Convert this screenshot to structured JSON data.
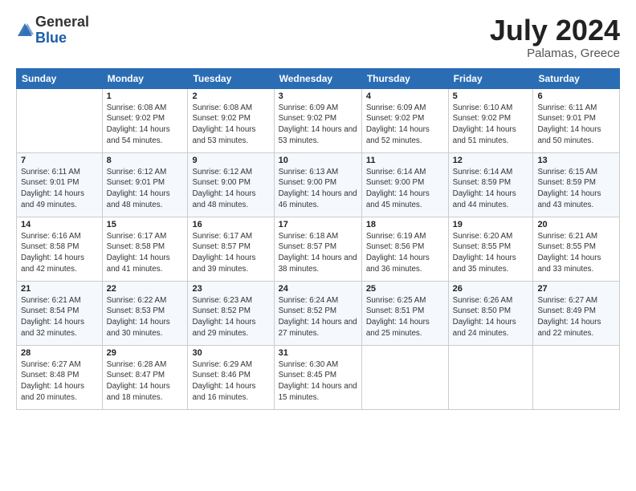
{
  "header": {
    "logo_general": "General",
    "logo_blue": "Blue",
    "month": "July 2024",
    "location": "Palamas, Greece"
  },
  "days_of_week": [
    "Sunday",
    "Monday",
    "Tuesday",
    "Wednesday",
    "Thursday",
    "Friday",
    "Saturday"
  ],
  "weeks": [
    [
      {
        "num": "",
        "sunrise": "",
        "sunset": "",
        "daylight": "",
        "empty": true
      },
      {
        "num": "1",
        "sunrise": "6:08 AM",
        "sunset": "9:02 PM",
        "daylight": "14 hours and 54 minutes."
      },
      {
        "num": "2",
        "sunrise": "6:08 AM",
        "sunset": "9:02 PM",
        "daylight": "14 hours and 53 minutes."
      },
      {
        "num": "3",
        "sunrise": "6:09 AM",
        "sunset": "9:02 PM",
        "daylight": "14 hours and 53 minutes."
      },
      {
        "num": "4",
        "sunrise": "6:09 AM",
        "sunset": "9:02 PM",
        "daylight": "14 hours and 52 minutes."
      },
      {
        "num": "5",
        "sunrise": "6:10 AM",
        "sunset": "9:02 PM",
        "daylight": "14 hours and 51 minutes."
      },
      {
        "num": "6",
        "sunrise": "6:11 AM",
        "sunset": "9:01 PM",
        "daylight": "14 hours and 50 minutes."
      }
    ],
    [
      {
        "num": "7",
        "sunrise": "6:11 AM",
        "sunset": "9:01 PM",
        "daylight": "14 hours and 49 minutes."
      },
      {
        "num": "8",
        "sunrise": "6:12 AM",
        "sunset": "9:01 PM",
        "daylight": "14 hours and 48 minutes."
      },
      {
        "num": "9",
        "sunrise": "6:12 AM",
        "sunset": "9:00 PM",
        "daylight": "14 hours and 48 minutes."
      },
      {
        "num": "10",
        "sunrise": "6:13 AM",
        "sunset": "9:00 PM",
        "daylight": "14 hours and 46 minutes."
      },
      {
        "num": "11",
        "sunrise": "6:14 AM",
        "sunset": "9:00 PM",
        "daylight": "14 hours and 45 minutes."
      },
      {
        "num": "12",
        "sunrise": "6:14 AM",
        "sunset": "8:59 PM",
        "daylight": "14 hours and 44 minutes."
      },
      {
        "num": "13",
        "sunrise": "6:15 AM",
        "sunset": "8:59 PM",
        "daylight": "14 hours and 43 minutes."
      }
    ],
    [
      {
        "num": "14",
        "sunrise": "6:16 AM",
        "sunset": "8:58 PM",
        "daylight": "14 hours and 42 minutes."
      },
      {
        "num": "15",
        "sunrise": "6:17 AM",
        "sunset": "8:58 PM",
        "daylight": "14 hours and 41 minutes."
      },
      {
        "num": "16",
        "sunrise": "6:17 AM",
        "sunset": "8:57 PM",
        "daylight": "14 hours and 39 minutes."
      },
      {
        "num": "17",
        "sunrise": "6:18 AM",
        "sunset": "8:57 PM",
        "daylight": "14 hours and 38 minutes."
      },
      {
        "num": "18",
        "sunrise": "6:19 AM",
        "sunset": "8:56 PM",
        "daylight": "14 hours and 36 minutes."
      },
      {
        "num": "19",
        "sunrise": "6:20 AM",
        "sunset": "8:55 PM",
        "daylight": "14 hours and 35 minutes."
      },
      {
        "num": "20",
        "sunrise": "6:21 AM",
        "sunset": "8:55 PM",
        "daylight": "14 hours and 33 minutes."
      }
    ],
    [
      {
        "num": "21",
        "sunrise": "6:21 AM",
        "sunset": "8:54 PM",
        "daylight": "14 hours and 32 minutes."
      },
      {
        "num": "22",
        "sunrise": "6:22 AM",
        "sunset": "8:53 PM",
        "daylight": "14 hours and 30 minutes."
      },
      {
        "num": "23",
        "sunrise": "6:23 AM",
        "sunset": "8:52 PM",
        "daylight": "14 hours and 29 minutes."
      },
      {
        "num": "24",
        "sunrise": "6:24 AM",
        "sunset": "8:52 PM",
        "daylight": "14 hours and 27 minutes."
      },
      {
        "num": "25",
        "sunrise": "6:25 AM",
        "sunset": "8:51 PM",
        "daylight": "14 hours and 25 minutes."
      },
      {
        "num": "26",
        "sunrise": "6:26 AM",
        "sunset": "8:50 PM",
        "daylight": "14 hours and 24 minutes."
      },
      {
        "num": "27",
        "sunrise": "6:27 AM",
        "sunset": "8:49 PM",
        "daylight": "14 hours and 22 minutes."
      }
    ],
    [
      {
        "num": "28",
        "sunrise": "6:27 AM",
        "sunset": "8:48 PM",
        "daylight": "14 hours and 20 minutes."
      },
      {
        "num": "29",
        "sunrise": "6:28 AM",
        "sunset": "8:47 PM",
        "daylight": "14 hours and 18 minutes."
      },
      {
        "num": "30",
        "sunrise": "6:29 AM",
        "sunset": "8:46 PM",
        "daylight": "14 hours and 16 minutes."
      },
      {
        "num": "31",
        "sunrise": "6:30 AM",
        "sunset": "8:45 PM",
        "daylight": "14 hours and 15 minutes."
      },
      {
        "num": "",
        "sunrise": "",
        "sunset": "",
        "daylight": "",
        "empty": true
      },
      {
        "num": "",
        "sunrise": "",
        "sunset": "",
        "daylight": "",
        "empty": true
      },
      {
        "num": "",
        "sunrise": "",
        "sunset": "",
        "daylight": "",
        "empty": true
      }
    ]
  ],
  "labels": {
    "sunrise_prefix": "Sunrise: ",
    "sunset_prefix": "Sunset: ",
    "daylight_prefix": "Daylight: "
  }
}
